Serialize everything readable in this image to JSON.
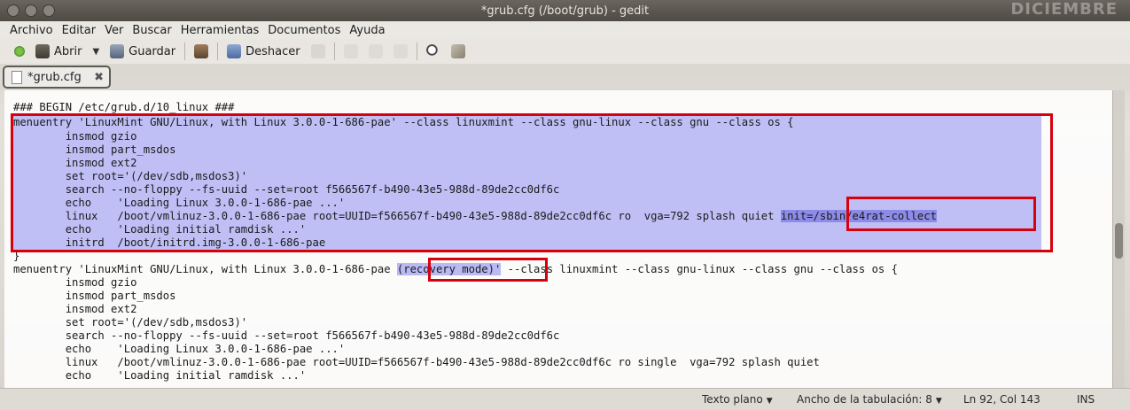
{
  "window": {
    "title": "*grub.cfg (/boot/grub) - gedit",
    "background_text": "DICIEMBRE"
  },
  "menubar": {
    "items": [
      "Archivo",
      "Editar",
      "Ver",
      "Buscar",
      "Herramientas",
      "Documentos",
      "Ayuda"
    ]
  },
  "toolbar": {
    "open_label": "Abrir",
    "save_label": "Guardar",
    "undo_label": "Deshacer"
  },
  "tab": {
    "label": "*grub.cfg"
  },
  "editor": {
    "lines": [
      "### BEGIN /etc/grub.d/10_linux ###",
      "menuentry 'LinuxMint GNU/Linux, with Linux 3.0.0-1-686-pae' --class linuxmint --class gnu-linux --class gnu --class os {",
      "        insmod gzio",
      "        insmod part_msdos",
      "        insmod ext2",
      "        set root='(/dev/sdb,msdos3)'",
      "        search --no-floppy --fs-uuid --set=root f566567f-b490-43e5-988d-89de2cc0df6c",
      "        echo    'Loading Linux 3.0.0-1-686-pae ...'",
      "        linux   /boot/vmlinuz-3.0.0-1-686-pae root=UUID=f566567f-b490-43e5-988d-89de2cc0df6c ro  vga=792 splash quiet ",
      "        echo    'Loading initial ramdisk ...'",
      "        initrd  /boot/initrd.img-3.0.0-1-686-pae",
      "}",
      "menuentry 'LinuxMint GNU/Linux, with Linux 3.0.0-1-686-pae ",
      "        insmod gzio",
      "        insmod part_msdos",
      "        insmod ext2",
      "        set root='(/dev/sdb,msdos3)'",
      "        search --no-floppy --fs-uuid --set=root f566567f-b490-43e5-988d-89de2cc0df6c",
      "        echo    'Loading Linux 3.0.0-1-686-pae ...'",
      "        linux   /boot/vmlinuz-3.0.0-1-686-pae root=UUID=f566567f-b490-43e5-988d-89de2cc0df6c ro single  vga=792 splash quiet",
      "        echo    'Loading initial ramdisk ...'"
    ],
    "init_option": "init=/sbin/e4rat-collect",
    "recovery_text": "(recovery mode)'",
    "recovery_rest": " --class linuxmint --class gnu-linux --class gnu --class os {"
  },
  "statusbar": {
    "language": "Texto plano",
    "tab_width": "Ancho de la tabulación:  8",
    "position": "Ln 92, Col 143",
    "mode": "INS"
  },
  "colors": {
    "selection": "#bfbff6",
    "highlight_border": "#d8000c"
  }
}
